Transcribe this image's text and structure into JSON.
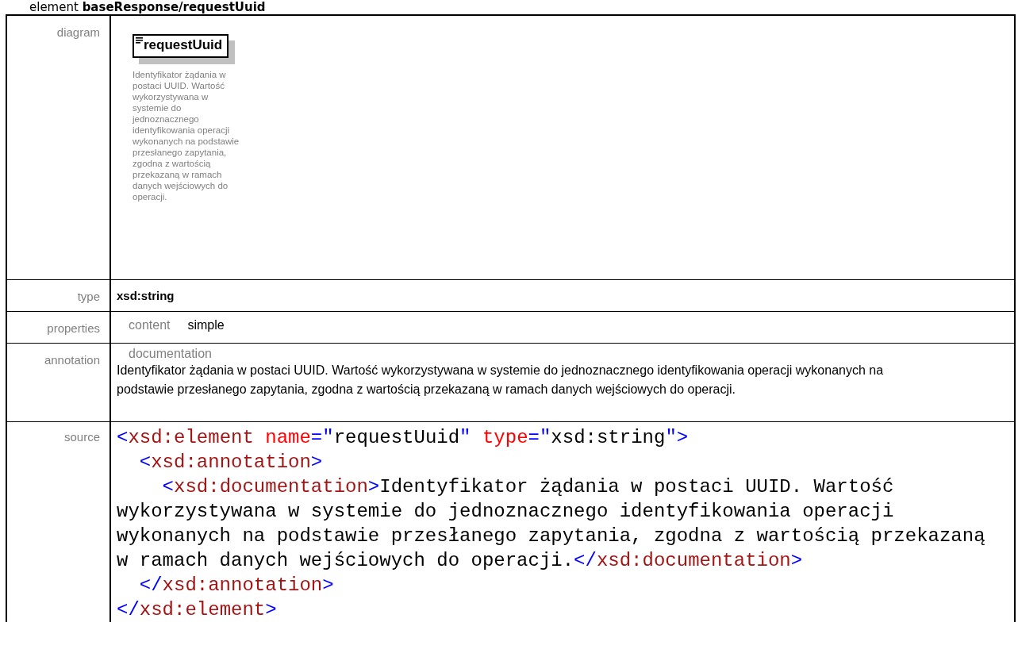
{
  "heading": {
    "prefix": "element",
    "path": "baseResponse/requestUuid"
  },
  "rows": [
    {
      "kind": "diagram",
      "label": "diagram",
      "element_name": "requestUuid",
      "description": "Identyfikator żądania w postaci UUID. Wartość wykorzystywana w systemie do jednoznacznego identyfikowania operacji wykonanych na podstawie przesłanego zapytania, zgodna z wartością przekazaną w ramach danych wejściowych do operacji."
    },
    {
      "kind": "type",
      "label": "type",
      "value": "xsd:string"
    },
    {
      "kind": "properties",
      "label": "properties",
      "items": [
        {
          "key": "content",
          "value": "simple"
        }
      ]
    },
    {
      "kind": "annotation",
      "label": "annotation",
      "title": "documentation",
      "text": "Identyfikator żądania w postaci UUID. Wartość wykorzystywana w systemie do jednoznacznego identyfikowania operacji wykonanych na podstawie przesłanego zapytania, zgodna z wartością przekazaną w ramach danych wejściowych do operacji."
    },
    {
      "kind": "source",
      "label": "source",
      "lines": [
        [
          {
            "kind": "punct",
            "text": "<"
          },
          {
            "kind": "tag",
            "text": "xsd:element"
          },
          {
            "kind": "attr",
            "text": " name"
          },
          {
            "kind": "punct",
            "text": "=\""
          },
          {
            "kind": "value",
            "text": "requestUuid"
          },
          {
            "kind": "punct",
            "text": "\""
          },
          {
            "kind": "attr",
            "text": " type"
          },
          {
            "kind": "punct",
            "text": "=\""
          },
          {
            "kind": "value",
            "text": "xsd:string"
          },
          {
            "kind": "punct",
            "text": "\">"
          }
        ],
        [
          {
            "kind": "punct",
            "text": "  <"
          },
          {
            "kind": "tag",
            "text": "xsd:annotation"
          },
          {
            "kind": "punct",
            "text": ">"
          }
        ],
        [
          {
            "kind": "punct",
            "text": "    <"
          },
          {
            "kind": "tag",
            "text": "xsd:documentation"
          },
          {
            "kind": "punct",
            "text": ">"
          },
          {
            "kind": "value",
            "text": "Identyfikator żądania w postaci UUID. Wartość"
          }
        ],
        [
          {
            "kind": "value",
            "text": "wykorzystywana w systemie do jednoznacznego identyfikowania operacji"
          }
        ],
        [
          {
            "kind": "value",
            "text": "wykonanych na podstawie przesłanego zapytania, zgodna z wartością przekazaną"
          }
        ],
        [
          {
            "kind": "value",
            "text": "w ramach danych wejściowych do operacji."
          },
          {
            "kind": "punct",
            "text": "</"
          },
          {
            "kind": "tag",
            "text": "xsd:documentation"
          },
          {
            "kind": "punct",
            "text": ">"
          }
        ],
        [
          {
            "kind": "punct",
            "text": "  </"
          },
          {
            "kind": "tag",
            "text": "xsd:annotation"
          },
          {
            "kind": "punct",
            "text": ">"
          }
        ],
        [
          {
            "kind": "punct",
            "text": "</"
          },
          {
            "kind": "tag",
            "text": "xsd:element"
          },
          {
            "kind": "punct",
            "text": ">"
          }
        ]
      ]
    }
  ]
}
